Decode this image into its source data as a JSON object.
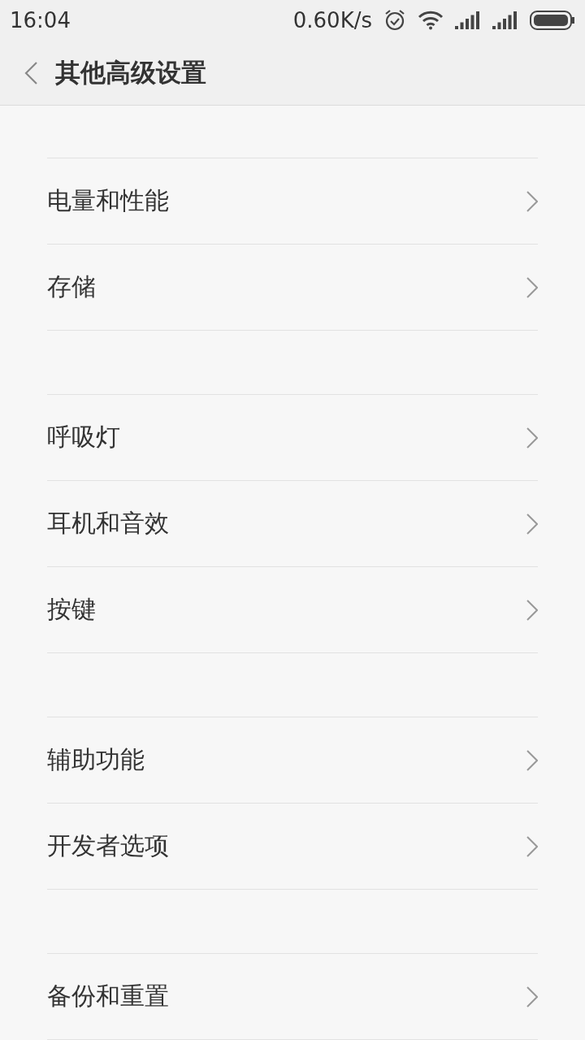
{
  "status_bar": {
    "time": "16:04",
    "speed": "0.60K/s"
  },
  "header": {
    "title": "其他高级设置"
  },
  "groups": [
    {
      "items": [
        {
          "label": "电量和性能"
        },
        {
          "label": "存储"
        }
      ]
    },
    {
      "items": [
        {
          "label": "呼吸灯"
        },
        {
          "label": "耳机和音效"
        },
        {
          "label": "按键"
        }
      ]
    },
    {
      "items": [
        {
          "label": "辅助功能"
        },
        {
          "label": "开发者选项"
        }
      ]
    },
    {
      "items": [
        {
          "label": "备份和重置"
        }
      ]
    }
  ]
}
